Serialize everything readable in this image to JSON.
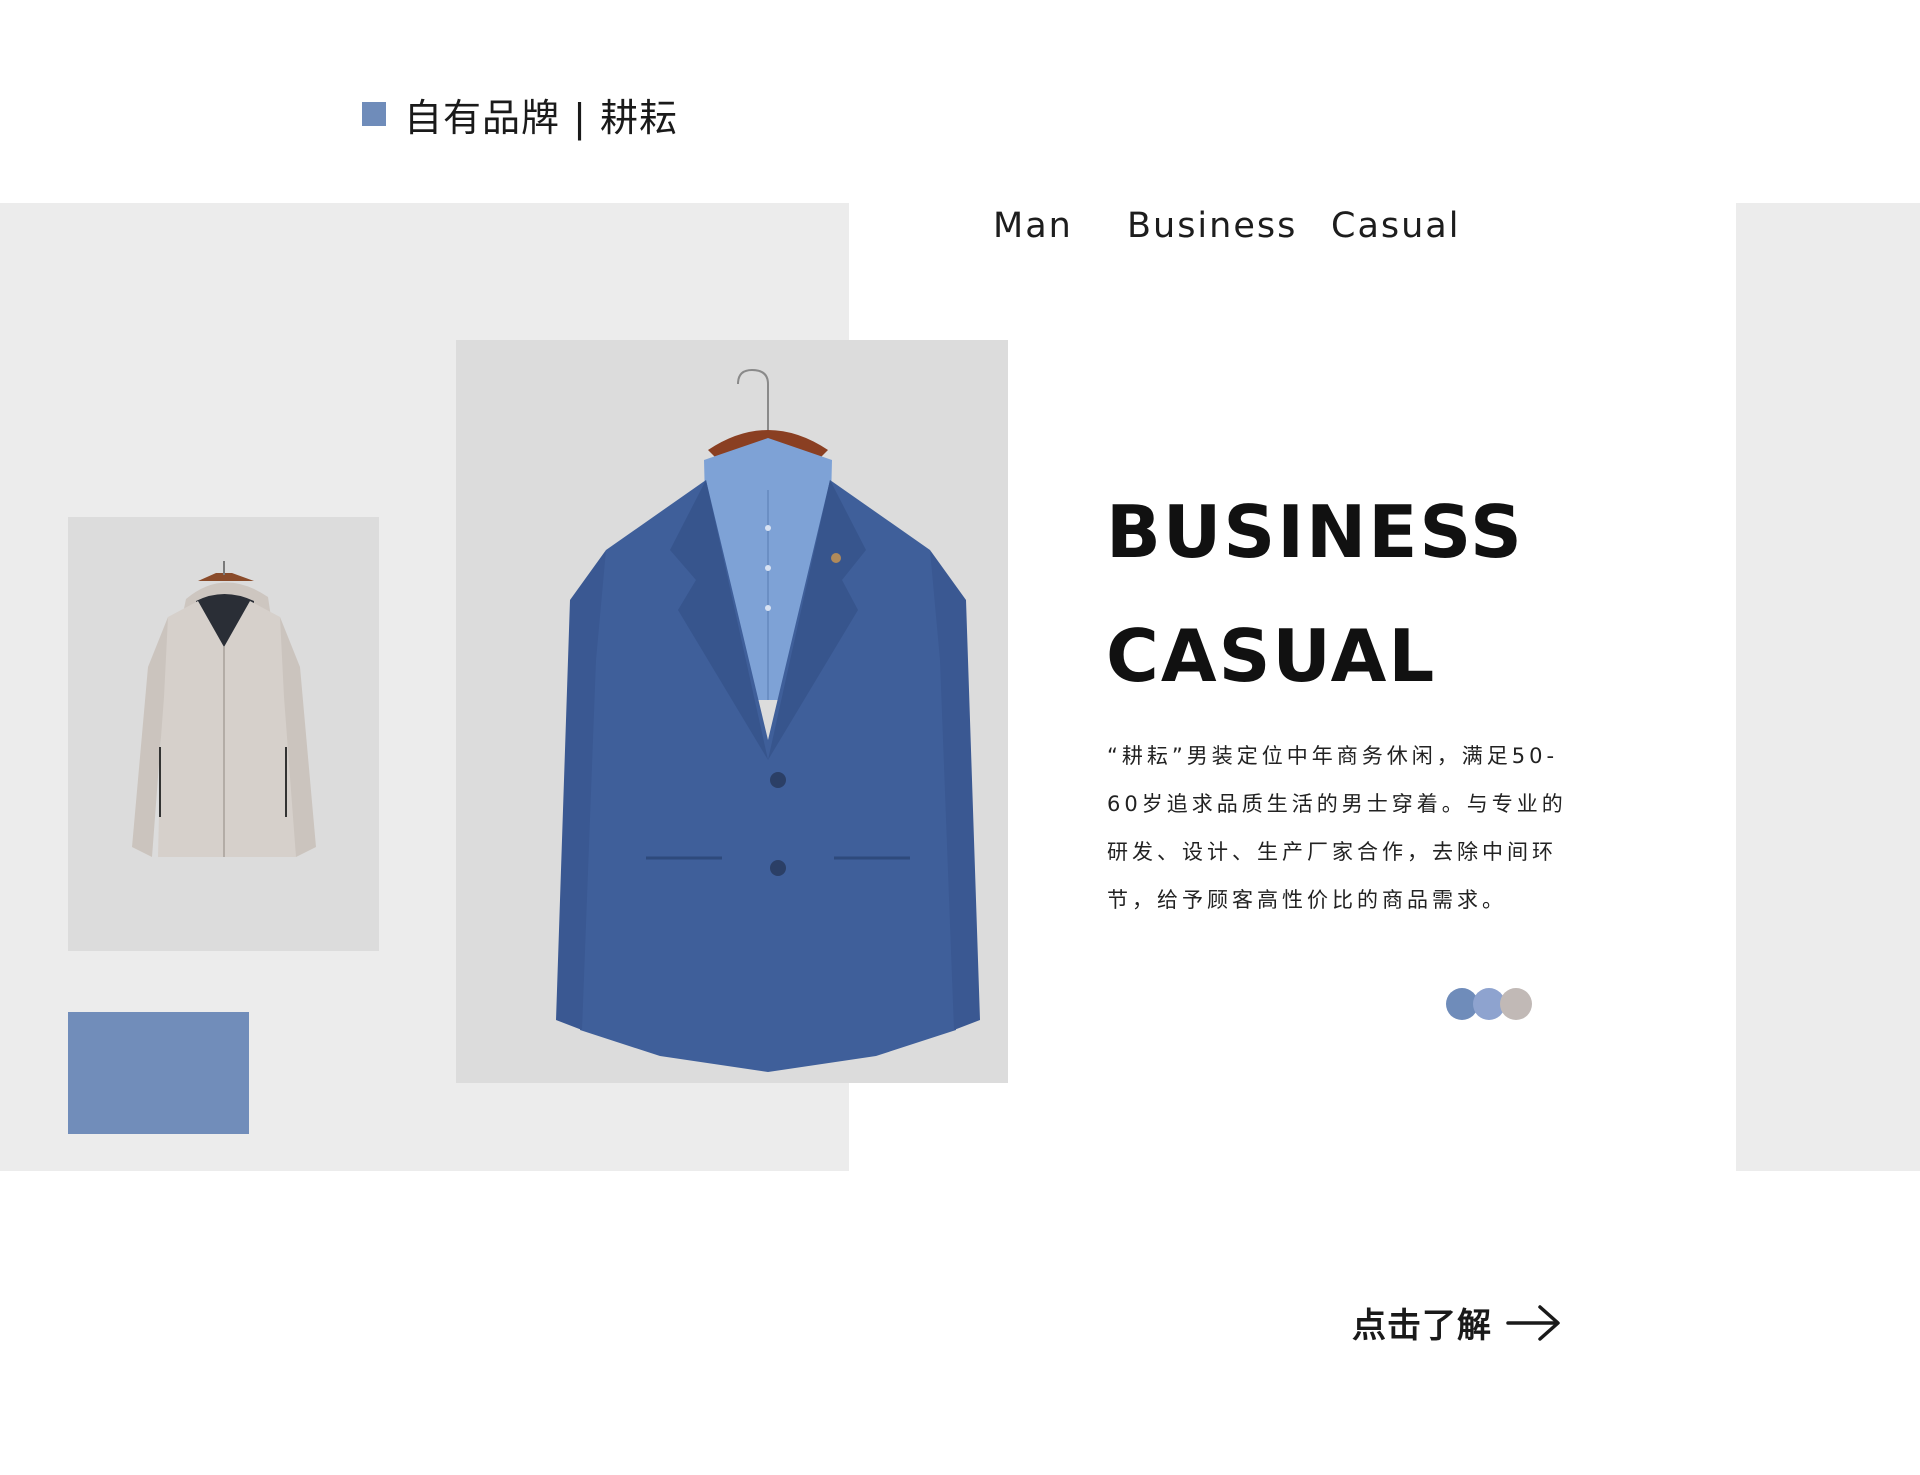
{
  "brand": {
    "title": "自有品牌 | 耕耘",
    "accent_color": "#6f8cba"
  },
  "nav": {
    "items": [
      {
        "label": "Man"
      },
      {
        "label": "Business"
      },
      {
        "label": "Casual"
      }
    ]
  },
  "hero": {
    "headline_line1": "BUSINESS",
    "headline_line2": "CASUAL",
    "description": "“耕耘”男装定位中年商务休闲，满足50-60岁追求品质生活的男士穿着。与专业的研发、设计、生产厂家合作，去除中间环节，给予顾客高性价比的商品需求。"
  },
  "products": {
    "small": {
      "icon": "hooded-jacket-image",
      "color": "#d6d0cb"
    },
    "main": {
      "icon": "navy-blazer-image",
      "color": "#3f5f9a"
    }
  },
  "swatches": [
    {
      "color": "#6f8cba"
    },
    {
      "color": "#8ea3cf"
    },
    {
      "color": "#c1b9b6"
    }
  ],
  "cta": {
    "label": "点击了解",
    "icon": "arrow-right-icon"
  },
  "colors": {
    "panel_gray": "#ececec",
    "card_gray": "#dcdcdc",
    "accent_block": "#718dba"
  }
}
